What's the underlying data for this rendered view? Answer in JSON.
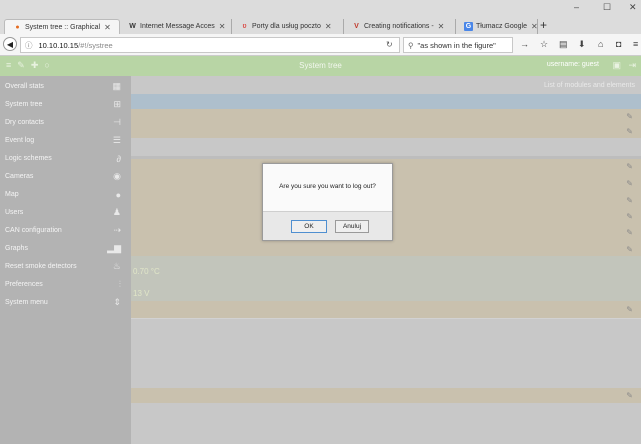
{
  "browser": {
    "tabs": [
      {
        "title": "System tree :: Graphical",
        "icon": "firefox-tab-icon",
        "active": true
      },
      {
        "title": "Internet Message Acces",
        "icon": "wikipedia-icon",
        "active": false
      },
      {
        "title": "Porty dla usług poczto",
        "icon": "site-tab-icon",
        "active": false
      },
      {
        "title": "Creating notifications -",
        "icon": "v-logo-icon",
        "active": false
      },
      {
        "title": "Tłumacz Google",
        "icon": "google-translate-icon",
        "active": false
      }
    ],
    "url_host": "10.10.10.15",
    "url_path": "/#!/systree",
    "search_text": "\"as shown in the figure\""
  },
  "app": {
    "title": "System tree",
    "user": "username: guest"
  },
  "sidebar": {
    "items": [
      {
        "label": "Overall stats",
        "icon": "grid-icon"
      },
      {
        "label": "System tree",
        "icon": "tree-icon"
      },
      {
        "label": "Dry contacts",
        "icon": "contact-icon"
      },
      {
        "label": "Event log",
        "icon": "list-icon"
      },
      {
        "label": "Logic schemes",
        "icon": "link-icon"
      },
      {
        "label": "Cameras",
        "icon": "eye-icon"
      },
      {
        "label": "Map",
        "icon": "map-pin-icon"
      },
      {
        "label": "Users",
        "icon": "users-icon"
      },
      {
        "label": "CAN configuration",
        "icon": "can-icon"
      },
      {
        "label": "Graphs",
        "icon": "bar-chart-icon"
      },
      {
        "label": "Reset smoke detectors",
        "icon": "fire-icon"
      },
      {
        "label": "Preferences",
        "icon": "sliders-icon"
      },
      {
        "label": "System menu",
        "icon": "updown-icon"
      }
    ]
  },
  "main": {
    "list_label": "List of modules and elements",
    "value_temp": "0.70 °C",
    "value_voltage": "13 V"
  },
  "dialog": {
    "message": "Are you sure you want to log out?",
    "ok_label": "OK",
    "cancel_label": "Anuluj"
  }
}
